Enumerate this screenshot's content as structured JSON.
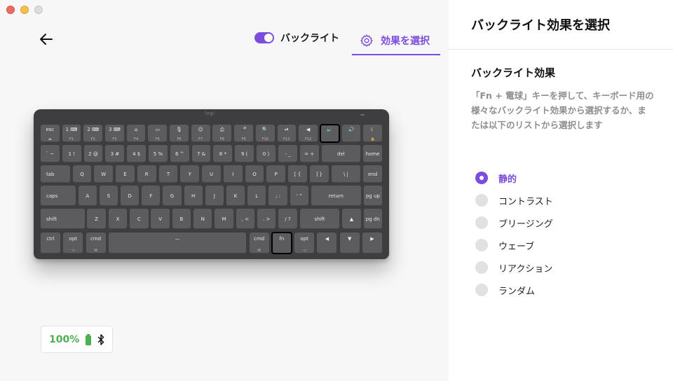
{
  "window": {
    "controls": [
      "close",
      "minimize",
      "zoom"
    ]
  },
  "toolbar": {
    "back_icon": "arrow-left-icon",
    "backlight_label": "バックライト",
    "backlight_on": true,
    "effects_label": "効果を選択",
    "effects_icon": "gear-icon"
  },
  "keyboard": {
    "logo": "logi",
    "rows": [
      [
        {
          "l": "esc",
          "s": "⏏"
        },
        {
          "l": "1 ⌨",
          "s": "F1"
        },
        {
          "l": "2 ⌨",
          "s": "F2"
        },
        {
          "l": "3 ⌨",
          "s": "F3"
        },
        {
          "l": "⌂",
          "s": "F4"
        },
        {
          "l": "▭",
          "s": "F5"
        },
        {
          "l": "🎙",
          "s": "F6"
        },
        {
          "l": "☺",
          "s": "F7"
        },
        {
          "l": "⎙",
          "s": "F8"
        },
        {
          "l": "🎤",
          "s": "F9"
        },
        {
          "l": "🔍",
          "s": "F10"
        },
        {
          "l": "⏯",
          "s": "F11"
        },
        {
          "l": "◀",
          "s": "F12"
        },
        {
          "l": "🔉",
          "s": ""
        },
        {
          "l": "🔊",
          "s": ""
        },
        {
          "l": "☾",
          "s": "🔒"
        }
      ],
      [
        {
          "l": "` ~",
          "s": ""
        },
        {
          "l": "1 !",
          "s": ""
        },
        {
          "l": "2 @",
          "s": ""
        },
        {
          "l": "3 #",
          "s": ""
        },
        {
          "l": "4 $",
          "s": ""
        },
        {
          "l": "5 %",
          "s": ""
        },
        {
          "l": "6 ^",
          "s": ""
        },
        {
          "l": "7 &",
          "s": ""
        },
        {
          "l": "8 *",
          "s": ""
        },
        {
          "l": "9 (",
          "s": ""
        },
        {
          "l": "0 )",
          "s": ""
        },
        {
          "l": "- _",
          "s": ""
        },
        {
          "l": "= +",
          "s": ""
        },
        {
          "l": "del",
          "s": ""
        },
        {
          "l": "home",
          "s": ""
        }
      ],
      [
        {
          "l": "tab",
          "s": ""
        },
        {
          "l": "Q",
          "s": ""
        },
        {
          "l": "W",
          "s": ""
        },
        {
          "l": "E",
          "s": ""
        },
        {
          "l": "R",
          "s": ""
        },
        {
          "l": "T",
          "s": ""
        },
        {
          "l": "Y",
          "s": ""
        },
        {
          "l": "U",
          "s": ""
        },
        {
          "l": "I",
          "s": ""
        },
        {
          "l": "O",
          "s": ""
        },
        {
          "l": "P",
          "s": ""
        },
        {
          "l": "[ {",
          "s": ""
        },
        {
          "l": "] }",
          "s": ""
        },
        {
          "l": "\\ |",
          "s": ""
        },
        {
          "l": "end",
          "s": ""
        }
      ],
      [
        {
          "l": "caps",
          "s": ""
        },
        {
          "l": "A",
          "s": ""
        },
        {
          "l": "S",
          "s": ""
        },
        {
          "l": "D",
          "s": ""
        },
        {
          "l": "F",
          "s": ""
        },
        {
          "l": "G",
          "s": ""
        },
        {
          "l": "H",
          "s": ""
        },
        {
          "l": "J",
          "s": ""
        },
        {
          "l": "K",
          "s": ""
        },
        {
          "l": "L",
          "s": ""
        },
        {
          "l": "; :",
          "s": ""
        },
        {
          "l": "' \"",
          "s": ""
        },
        {
          "l": "return",
          "s": ""
        },
        {
          "l": "pg up",
          "s": ""
        }
      ],
      [
        {
          "l": "shift",
          "s": ""
        },
        {
          "l": "Z",
          "s": ""
        },
        {
          "l": "X",
          "s": ""
        },
        {
          "l": "C",
          "s": ""
        },
        {
          "l": "V",
          "s": ""
        },
        {
          "l": "B",
          "s": ""
        },
        {
          "l": "N",
          "s": ""
        },
        {
          "l": "M",
          "s": ""
        },
        {
          "l": ", <",
          "s": ""
        },
        {
          "l": ". >",
          "s": ""
        },
        {
          "l": "/ ?",
          "s": ""
        },
        {
          "l": "shift",
          "s": ""
        },
        {
          "l": "▲",
          "s": ""
        },
        {
          "l": "pg dn",
          "s": ""
        }
      ],
      [
        {
          "l": "ctrl",
          "s": ""
        },
        {
          "l": "opt",
          "s": "⌥"
        },
        {
          "l": "cmd",
          "s": "⌘"
        },
        {
          "l": "—",
          "s": ""
        },
        {
          "l": "cmd",
          "s": "⌘"
        },
        {
          "l": "fn",
          "s": ""
        },
        {
          "l": "opt",
          "s": "⌥"
        },
        {
          "l": "◀",
          "s": ""
        },
        {
          "l": "▼",
          "s": ""
        },
        {
          "l": "▶",
          "s": ""
        }
      ]
    ]
  },
  "battery": {
    "percent": "100%",
    "color": "#4caf50"
  },
  "panel": {
    "title": "バックライト効果を選択",
    "section_title": "バックライト効果",
    "description": "「Fn + 電球」キーを押して、キーボード用の様々なバックライト効果から選択するか、または以下のリストから選択します",
    "options": [
      {
        "label": "静的",
        "selected": true
      },
      {
        "label": "コントラスト",
        "selected": false
      },
      {
        "label": "ブリージング",
        "selected": false
      },
      {
        "label": "ウェーブ",
        "selected": false
      },
      {
        "label": "リアクション",
        "selected": false
      },
      {
        "label": "ランダム",
        "selected": false
      }
    ]
  },
  "colors": {
    "accent": "#7c4ddc",
    "radio_off": "#e1e1e1",
    "desc_text": "#8e8e8e"
  }
}
